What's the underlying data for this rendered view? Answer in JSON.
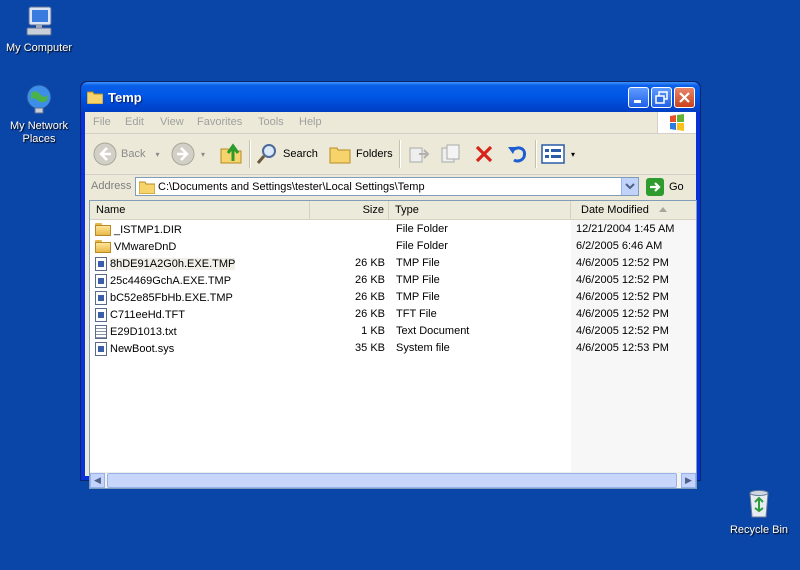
{
  "desktop": {
    "icons": [
      {
        "label": "My Computer"
      },
      {
        "label": "My Network Places",
        "label_line1": "My Network",
        "label_line2": "Places"
      },
      {
        "label": "Recycle Bin"
      }
    ]
  },
  "window": {
    "title": "Temp",
    "menu": [
      "File",
      "Edit",
      "View",
      "Favorites",
      "Tools",
      "Help"
    ],
    "toolbar": {
      "back_label": "Back",
      "search_label": "Search",
      "folders_label": "Folders"
    },
    "address": {
      "label": "Address",
      "value": "C:\\Documents and Settings\\tester\\Local Settings\\Temp",
      "go_label": "Go"
    },
    "columns": {
      "name": "Name",
      "size": "Size",
      "type": "Type",
      "date": "Date Modified"
    },
    "files": [
      {
        "name": "_ISTMP1.DIR",
        "size": "",
        "type": "File Folder",
        "date": "12/21/2004 1:45 AM",
        "icon": "folder-icon"
      },
      {
        "name": "VMwareDnD",
        "size": "",
        "type": "File Folder",
        "date": "6/2/2005 6:46 AM",
        "icon": "folder-icon"
      },
      {
        "name": "8hDE91A2G0h.EXE.TMP",
        "size": "26 KB",
        "type": "TMP File",
        "date": "4/6/2005 12:52 PM",
        "icon": "file-icon"
      },
      {
        "name": "25c4469GchA.EXE.TMP",
        "size": "26 KB",
        "type": "TMP File",
        "date": "4/6/2005 12:52 PM",
        "icon": "file-icon"
      },
      {
        "name": "bC52e85FbHb.EXE.TMP",
        "size": "26 KB",
        "type": "TMP File",
        "date": "4/6/2005 12:52 PM",
        "icon": "file-icon"
      },
      {
        "name": "C711eeHd.TFT",
        "size": "26 KB",
        "type": "TFT File",
        "date": "4/6/2005 12:52 PM",
        "icon": "file-icon"
      },
      {
        "name": "E29D1013.txt",
        "size": "1 KB",
        "type": "Text Document",
        "date": "4/6/2005 12:52 PM",
        "icon": "text-file-icon"
      },
      {
        "name": "NewBoot.sys",
        "size": "35 KB",
        "type": "System file",
        "date": "4/6/2005 12:53 PM",
        "icon": "system-file-icon"
      }
    ]
  },
  "colors": {
    "desktop_bg": "#0a45a8",
    "titlebar": "#0058e6",
    "window_bg": "#ece9d8"
  }
}
